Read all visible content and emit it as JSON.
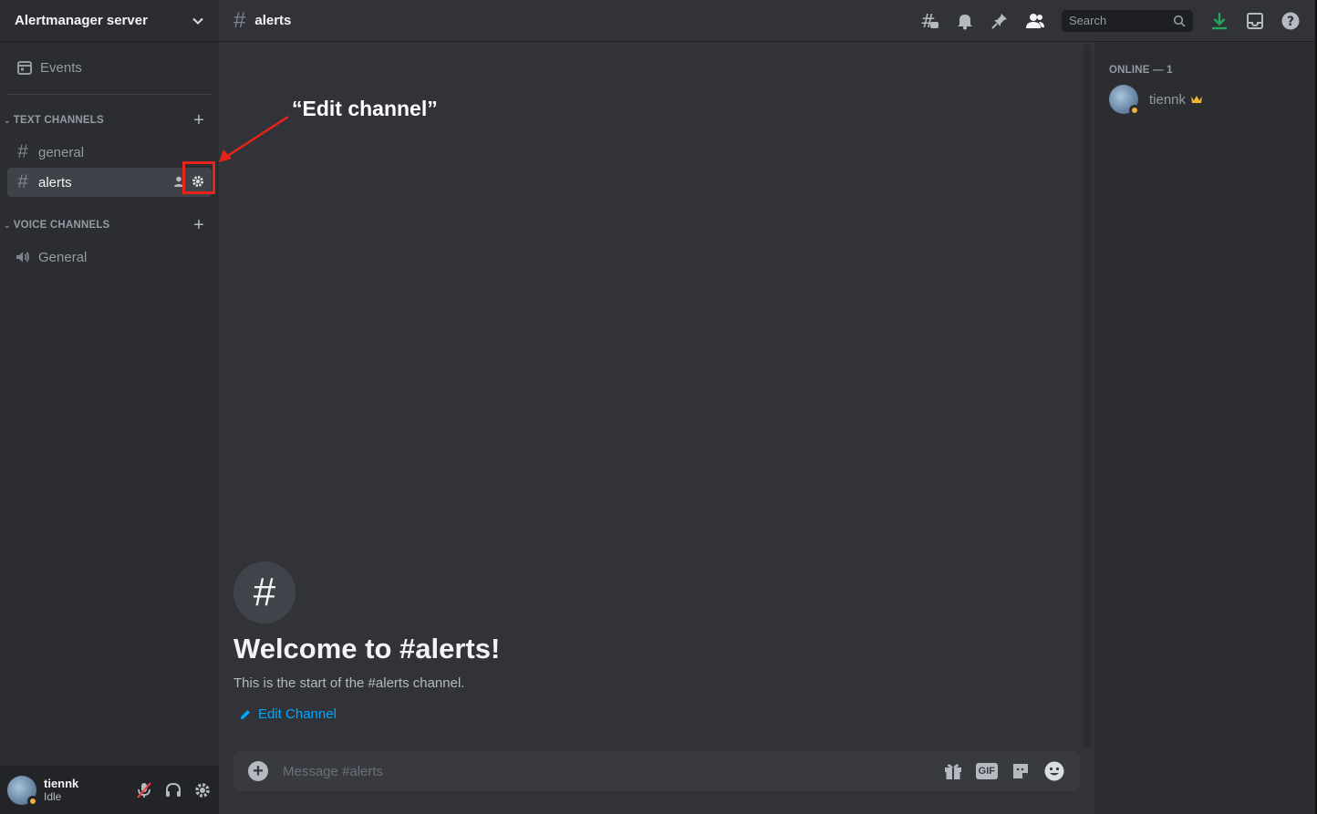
{
  "server": {
    "name": "Alertmanager server"
  },
  "sidebar": {
    "events_label": "Events",
    "text_category": "TEXT CHANNELS",
    "voice_category": "VOICE CHANNELS",
    "text_channels": [
      {
        "name": "general"
      },
      {
        "name": "alerts"
      }
    ],
    "voice_channels": [
      {
        "name": "General"
      }
    ]
  },
  "annotation": {
    "label": "“Edit channel”",
    "color": "#e8231a"
  },
  "user_panel": {
    "name": "tiennk",
    "status": "Idle"
  },
  "topbar": {
    "channel_name": "alerts",
    "search_placeholder": "Search",
    "icons": [
      "threads-icon",
      "bell-icon",
      "pin-icon",
      "members-icon",
      "search-icon",
      "download-icon",
      "inbox-icon",
      "help-icon"
    ]
  },
  "chat": {
    "welcome_title": "Welcome to #alerts!",
    "welcome_subtitle": "This is the start of the #alerts channel.",
    "edit_channel_label": "Edit Channel",
    "composer_placeholder": "Message #alerts",
    "gif_label": "GIF"
  },
  "members": {
    "header": "ONLINE — 1",
    "list": [
      {
        "name": "tiennk",
        "status": "idle",
        "owner": true
      }
    ]
  },
  "colors": {
    "accent_link": "#00a8fc",
    "idle_status": "#f0b232",
    "download_green": "#23a55a",
    "crown": "#f0b232"
  }
}
